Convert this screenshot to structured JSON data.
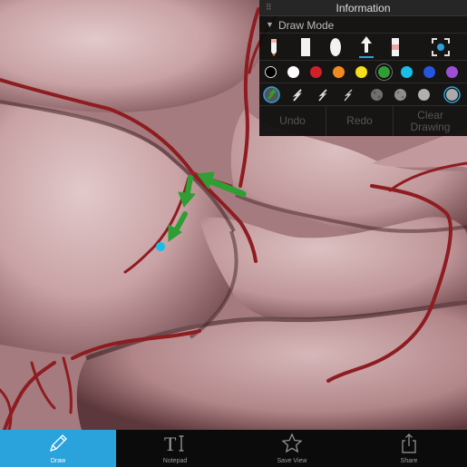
{
  "panel": {
    "title": "Information",
    "mode_label": "Draw Mode",
    "tools": [
      {
        "icon": "pencil-icon"
      },
      {
        "icon": "rectangle-icon"
      },
      {
        "icon": "ellipse-icon"
      },
      {
        "icon": "arrow-icon",
        "selected": true
      },
      {
        "icon": "eraser-icon"
      },
      {
        "icon": "center-view-icon"
      }
    ],
    "colors": [
      "#000000",
      "#ffffff",
      "#d0202a",
      "#f08a1e",
      "#f3df1a",
      "#2f9e34",
      "#17bfe6",
      "#2456e0",
      "#9b4fd4"
    ],
    "selected_color": "#2f9e34",
    "styles": [
      {
        "icon": "stroke-thick-icon",
        "selected": true
      },
      {
        "icon": "stroke-medium-icon"
      },
      {
        "icon": "stroke-thin-icon"
      },
      {
        "icon": "stroke-fine-icon"
      },
      {
        "icon": "opacity-25-icon"
      },
      {
        "icon": "opacity-50-icon"
      },
      {
        "icon": "opacity-75-icon"
      },
      {
        "icon": "opacity-100-icon",
        "selected": true
      }
    ],
    "actions": {
      "undo": "Undo",
      "redo": "Redo",
      "clear": "Clear Drawing"
    }
  },
  "toolbar": {
    "items": [
      {
        "label": "Draw",
        "icon": "pencil-icon",
        "active": true
      },
      {
        "label": "Notepad",
        "icon": "text-icon"
      },
      {
        "label": "Save View",
        "icon": "star-icon"
      },
      {
        "label": "Share",
        "icon": "share-icon"
      }
    ]
  },
  "annotation": {
    "arrow_color": "#2f9e34",
    "point_color": "#17bfe6"
  }
}
